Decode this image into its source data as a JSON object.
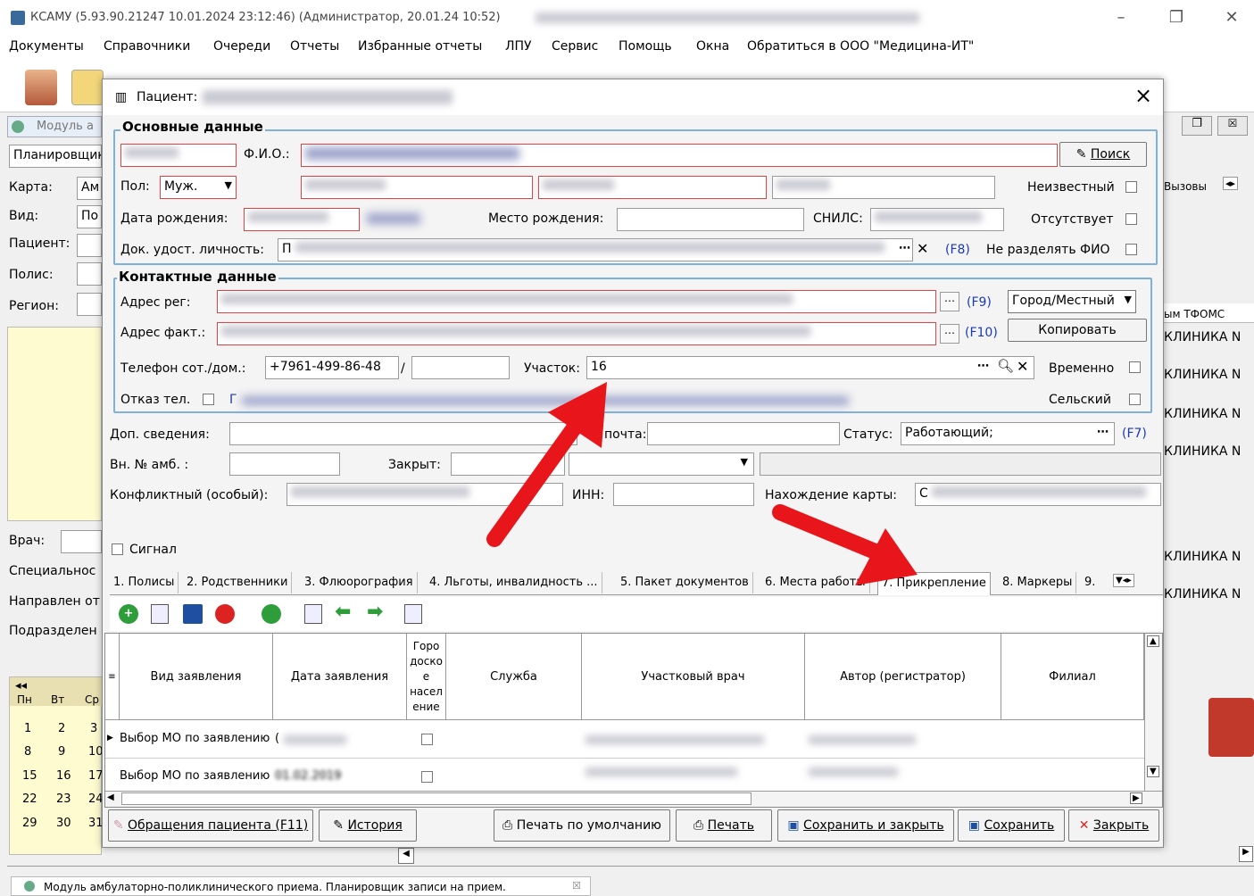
{
  "window": {
    "title": "КСАМУ (5.93.90.21247 10.01.2024 23:12:46) (Администратор, 20.01.24 10:52)"
  },
  "menu": [
    "Документы",
    "Справочники",
    "Очереди",
    "Отчеты",
    "Избранные отчеты",
    "ЛПУ",
    "Сервис",
    "Помощь",
    "Окна",
    "Обратиться в ООО \"Медицина-ИТ\""
  ],
  "background": {
    "module_tab": "Модуль а",
    "planner": "Планировщик",
    "labels": {
      "card": "Карта:",
      "kind": "Вид:",
      "patient": "Пациент:",
      "policy": "Полис:",
      "region": "Регион:",
      "doctor": "Врач:",
      "specialty": "Специальнос",
      "directed": "Направлен от",
      "division": "Подразделен"
    },
    "card_val": "Ам",
    "kind_val": "По",
    "right_header": "Вызовы",
    "tfoms_header": "ым ТФОМС",
    "clinic_rows": [
      "КЛИНИКА N",
      "КЛИНИКА N",
      "КЛИНИКА N",
      "КЛИНИКА N",
      "КЛИНИКА N",
      "КЛИНИКА N"
    ],
    "calendar": {
      "days": [
        "Пн",
        "Вт",
        "Ср"
      ],
      "rows": [
        [
          "1",
          "2",
          "3"
        ],
        [
          "8",
          "9",
          "10"
        ],
        [
          "15",
          "16",
          "17"
        ],
        [
          "22",
          "23",
          "24"
        ],
        [
          "29",
          "30",
          "31"
        ]
      ]
    },
    "bottom_tab": "Модуль амбулаторно-поликлинического приема. Планировщик записи на прием."
  },
  "dialog": {
    "title": "Пациент:",
    "close": "×",
    "main_group": "Основные данные",
    "fio_label": "Ф.И.О.:",
    "search_btn": "Поиск",
    "sex_label": "Пол:",
    "sex_value": "Муж.",
    "unknown_label": "Неизвестный",
    "dob_label": "Дата рождения:",
    "birthplace_label": "Место рождения:",
    "snils_label": "СНИЛС:",
    "absent_label": "Отсутствует",
    "doc_label": "Док. удост. личность:",
    "doc_value": "П",
    "f8": "(F8)",
    "nosplit_label": "Не разделять ФИО",
    "contact_group": "Контактные данные",
    "addr_reg_label": "Адрес рег:",
    "f9": "(F9)",
    "city_value": "Город/Местный",
    "addr_fact_label": "Адрес факт.:",
    "f10": "(F10)",
    "copy_btn": "Копировать",
    "phone_label": "Телефон сот./дом.:",
    "phone_value": "+7961-499-86-48",
    "slash": "/",
    "district_label": "Участок:",
    "district_value": "16",
    "temp_label": "Временно",
    "refuse_label": "Отказ тел.",
    "refuse_prefix": "Г",
    "rural_label": "Сельский",
    "extra_label": "Доп. сведения:",
    "email_label": "почта:",
    "status_label": "Статус:",
    "status_value": "Работающий;",
    "f7": "(F7)",
    "amb_label": "Вн. № амб. :",
    "closed_label": "Закрыт:",
    "conflict_label": "Конфликтный (особый):",
    "inn_label": "ИНН:",
    "card_location_label": "Нахождение карты:",
    "card_location_prefix": "С",
    "signal_label": "Сигнал",
    "tabs": [
      "1. Полисы",
      "2. Родственники",
      "3. Флюорография",
      "4. Льготы, инвалидность ...",
      "5. Пакет документов",
      "6. Места работы",
      "7. Прикрепление",
      "8. Маркеры",
      "9."
    ],
    "grid_headers": [
      "Вид заявления",
      "Дата заявления",
      "Городское население",
      "Служба",
      "Участковый врач",
      "Автор (регистратор)",
      "Филиал"
    ],
    "grid_city_header_lines": [
      "Горо",
      "доско",
      "е",
      "насел",
      "ение"
    ],
    "grid_rows": [
      {
        "kind": "Выбор МО по заявлению",
        "date": "("
      },
      {
        "kind": "Выбор МО по заявлению",
        "date": "01.02.2019"
      }
    ],
    "footer_buttons": {
      "visits": "Обращения пациента (F11)",
      "history": "История",
      "print_default": "Печать по умолчанию",
      "print": "Печать",
      "save_close": "Сохранить и закрыть",
      "save": "Сохранить",
      "close": "Закрыть"
    }
  }
}
